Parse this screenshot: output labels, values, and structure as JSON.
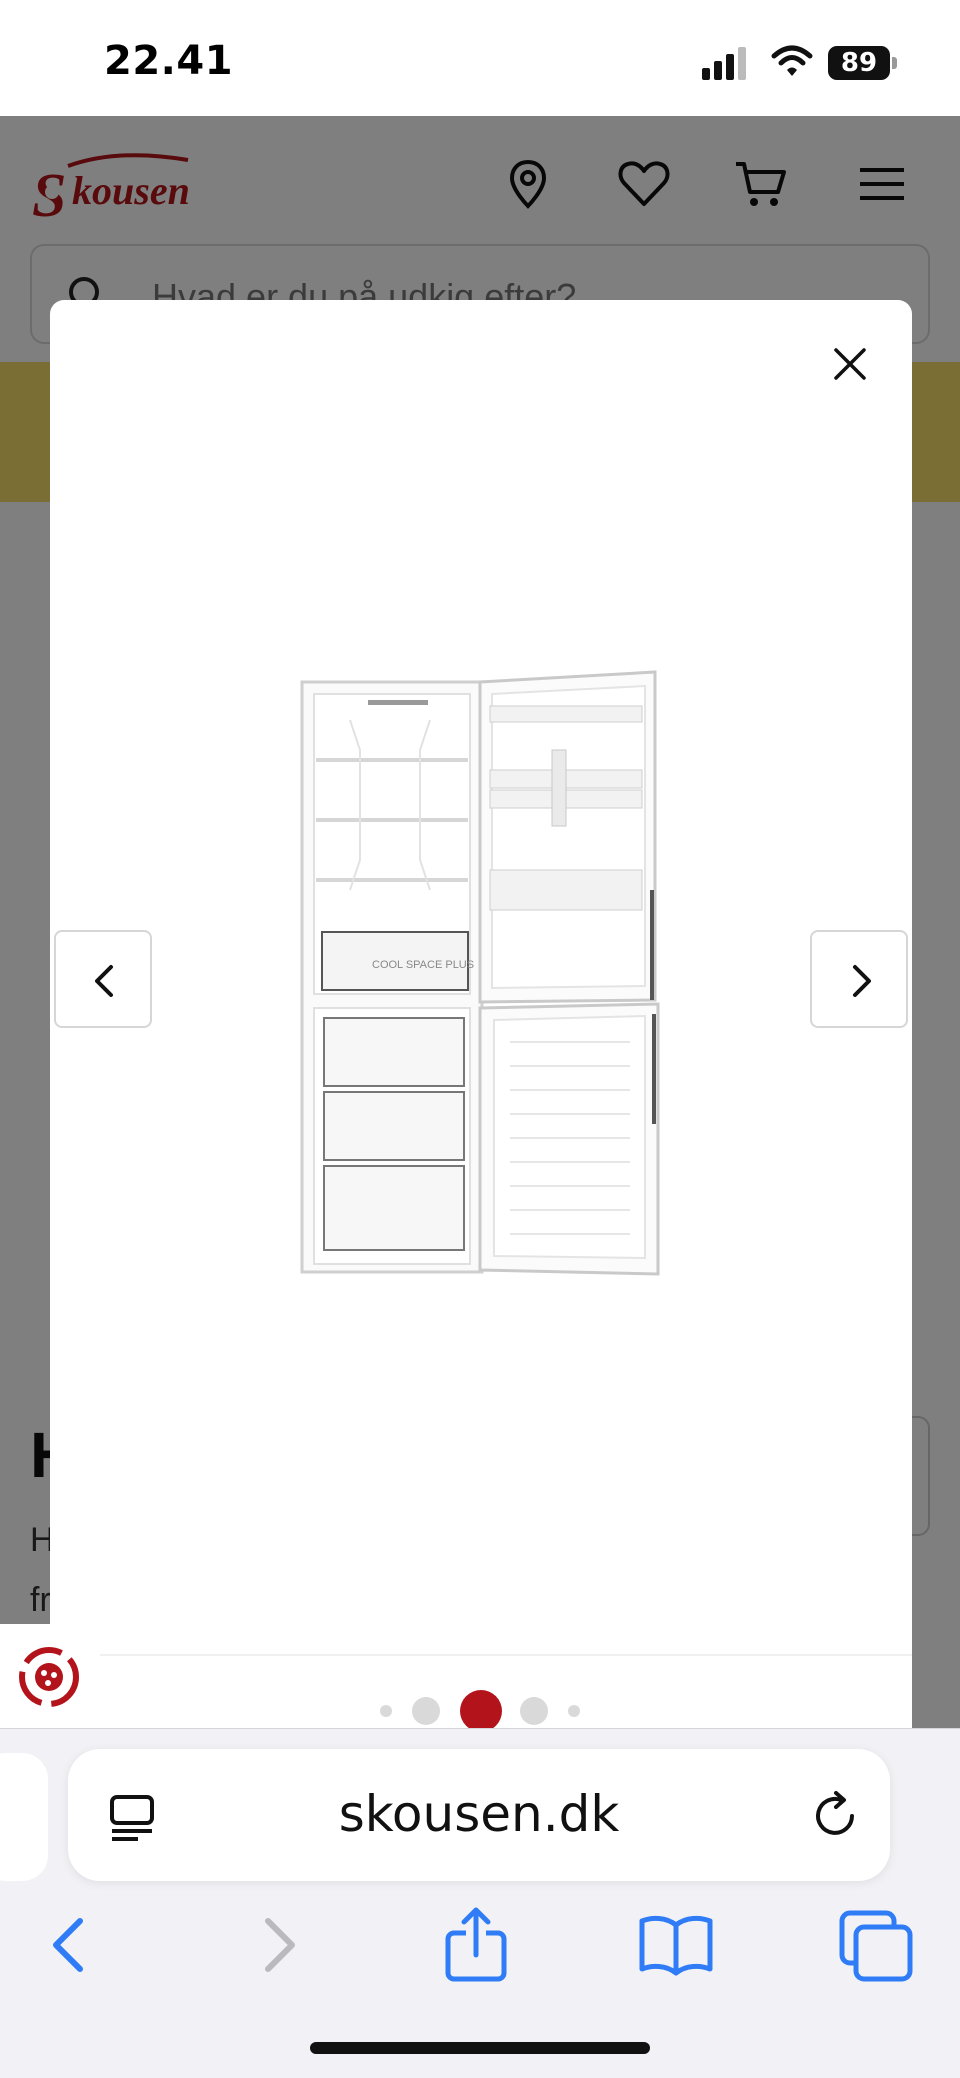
{
  "status_bar": {
    "time": "22.41",
    "battery": "89"
  },
  "site": {
    "logo_text": "Skousen",
    "search_placeholder": "Hvad er du på udkig efter?",
    "product_title_fragment": "H",
    "product_desc_line1": "H",
    "product_desc_line2": "fr"
  },
  "modal": {
    "image_alt": "Hvidt kombiskab med åbne døre",
    "image_label": "COOL SPACE PLUS",
    "carousel": {
      "total_dots": 5,
      "active_index": 2
    }
  },
  "browser": {
    "url": "skousen.dk"
  },
  "colors": {
    "brand_red": "#b3141b",
    "safari_blue": "#2f7cf6",
    "overlay": "rgba(0,0,0,0.5)",
    "promo_yellow": "#f4dc6a"
  },
  "icons": {
    "header": [
      "location-pin-icon",
      "heart-icon",
      "cart-icon",
      "menu-icon"
    ],
    "toolbar": [
      "back-arrow-icon",
      "forward-arrow-icon",
      "share-icon",
      "bookmarks-icon",
      "tabs-icon"
    ]
  }
}
